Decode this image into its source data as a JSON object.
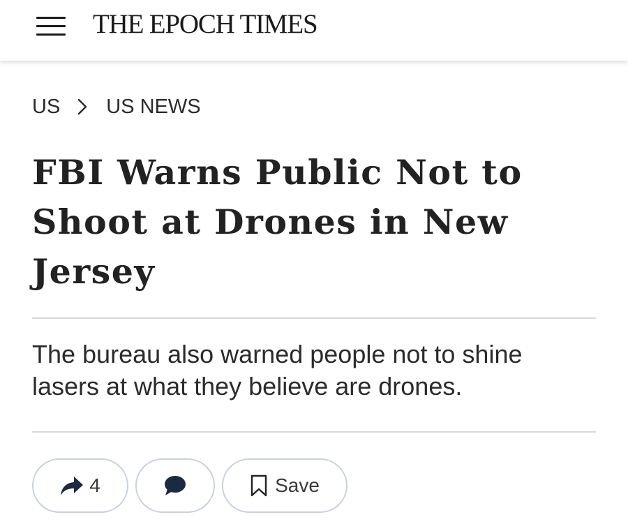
{
  "header": {
    "menu_icon": "hamburger-menu-icon",
    "brand": "THE EPOCH TIMES"
  },
  "breadcrumb": {
    "section": "US",
    "separator_icon": "chevron-right-icon",
    "subsection": "US NEWS"
  },
  "article": {
    "headline": "FBI Warns Public Not to Shoot at Drones in New Jersey",
    "subheadline": "The bureau also warned people not to shine lasers at what they believe are drones."
  },
  "actions": {
    "share_icon": "share-arrow-icon",
    "share_count": "4",
    "comment_icon": "comment-bubble-icon",
    "save_icon": "bookmark-icon",
    "save_label": "Save"
  },
  "colors": {
    "text": "#1f1f1f",
    "icon_navy": "#1b2a41",
    "pill_border": "#c9d1dd",
    "rule": "#d8d8d8"
  }
}
